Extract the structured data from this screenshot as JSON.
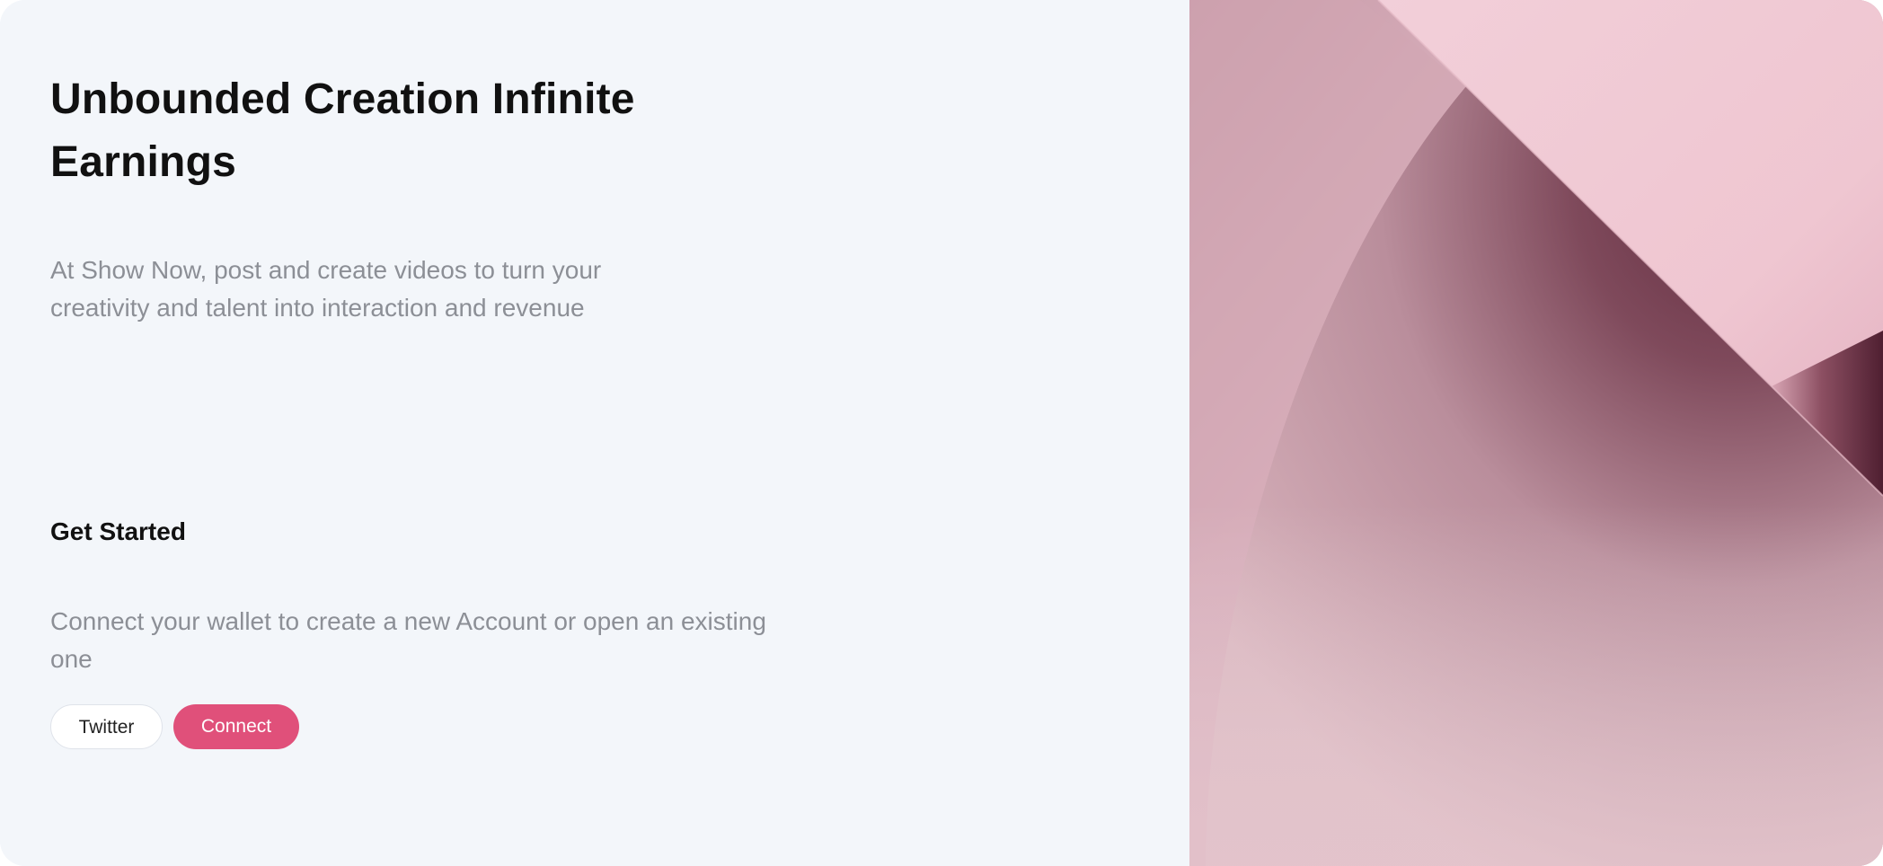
{
  "hero": {
    "title": "Unbounded Creation Infinite Earnings",
    "subtitle": "At Show Now, post and create videos to turn your creativity and talent into interaction and revenue"
  },
  "get_started": {
    "title": "Get Started",
    "description": "Connect your wallet to create a new Account or open an existing one"
  },
  "buttons": {
    "twitter_label": "Twitter",
    "connect_label": "Connect"
  },
  "colors": {
    "page_background": "#f3f6fa",
    "accent": "#e0507a",
    "title_text": "#111111",
    "muted_text": "#8c8f96",
    "artwork_light_pink": "#f3cfd9",
    "artwork_dark_plum": "#5e2a3d"
  }
}
